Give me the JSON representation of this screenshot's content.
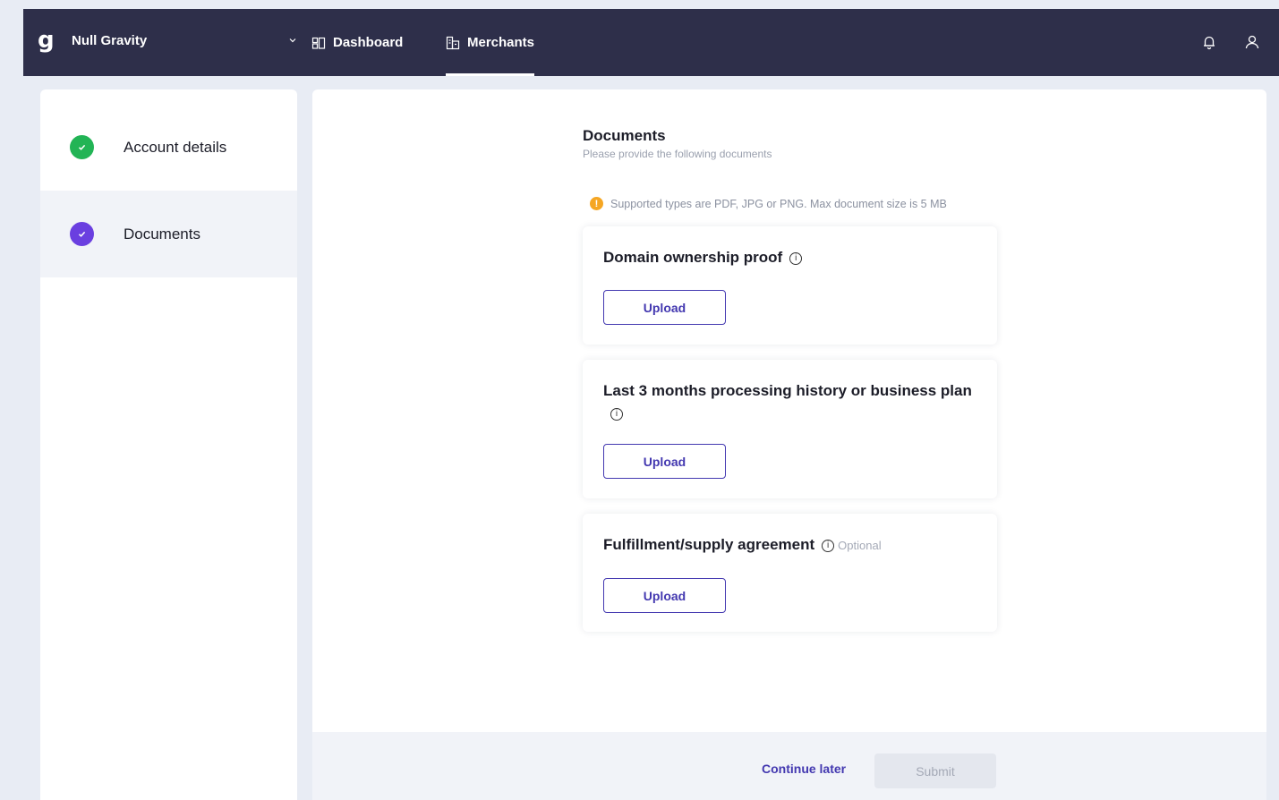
{
  "topbar": {
    "brand_name": "Null Gravity",
    "nav": [
      {
        "label": "Dashboard",
        "icon": "dashboard-icon"
      },
      {
        "label": "Merchants",
        "icon": "merchants-icon",
        "active": true
      }
    ]
  },
  "sidebar": {
    "steps": [
      {
        "label": "Account details",
        "status": "complete",
        "color": "#22b455"
      },
      {
        "label": "Documents",
        "status": "current",
        "color": "#6a3fe0"
      }
    ]
  },
  "main": {
    "title": "Documents",
    "subtitle": "Please provide the following documents",
    "notice": "Supported types are PDF, JPG or PNG. Max document size is 5 MB",
    "documents": [
      {
        "title": "Domain ownership proof",
        "button": "Upload"
      },
      {
        "title": "Last 3 months processing history or business plan",
        "button": "Upload"
      },
      {
        "title": "Fulfillment/supply agreement",
        "optional": "Optional",
        "button": "Upload"
      }
    ]
  },
  "footer": {
    "continue_label": "Continue later",
    "submit_label": "Submit"
  },
  "colors": {
    "topbar": "#2e2f4a",
    "accent": "#4338b0",
    "success": "#22b455",
    "current": "#6a3fe0",
    "warning": "#f5a623"
  }
}
